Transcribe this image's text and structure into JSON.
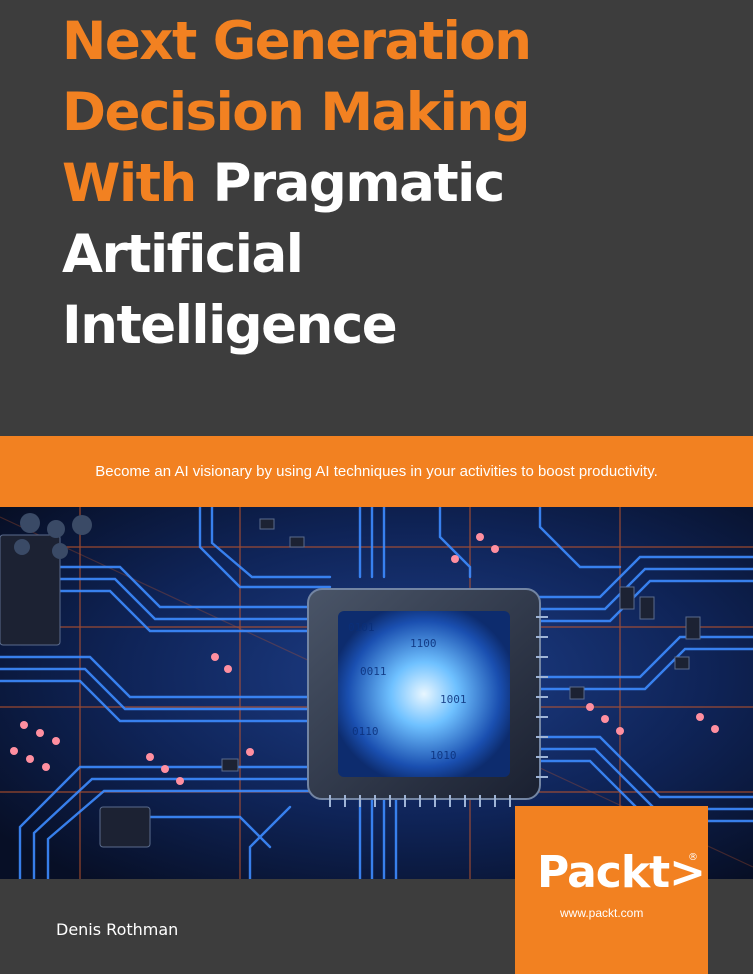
{
  "title": {
    "line1": "Next Generation",
    "line2": "Decision Making",
    "line3_orange": "With",
    "line3_white": "Pragmatic",
    "line4": "Artificial",
    "line5": "Intelligence"
  },
  "tagline": "Become an AI visionary by using AI techniques in your activities to boost productivity.",
  "author": "Denis Rothman",
  "publisher": {
    "logo": "Packt>",
    "registered": "®",
    "url": "www.packt.com"
  },
  "colors": {
    "background": "#3d3d3d",
    "accent": "#f28121",
    "text": "#ffffff"
  },
  "cover_art": {
    "icon": "circuit-board-chip-image",
    "chip_text": [
      "0101",
      "1100",
      "0011",
      "1001",
      "0110",
      "1010"
    ]
  }
}
